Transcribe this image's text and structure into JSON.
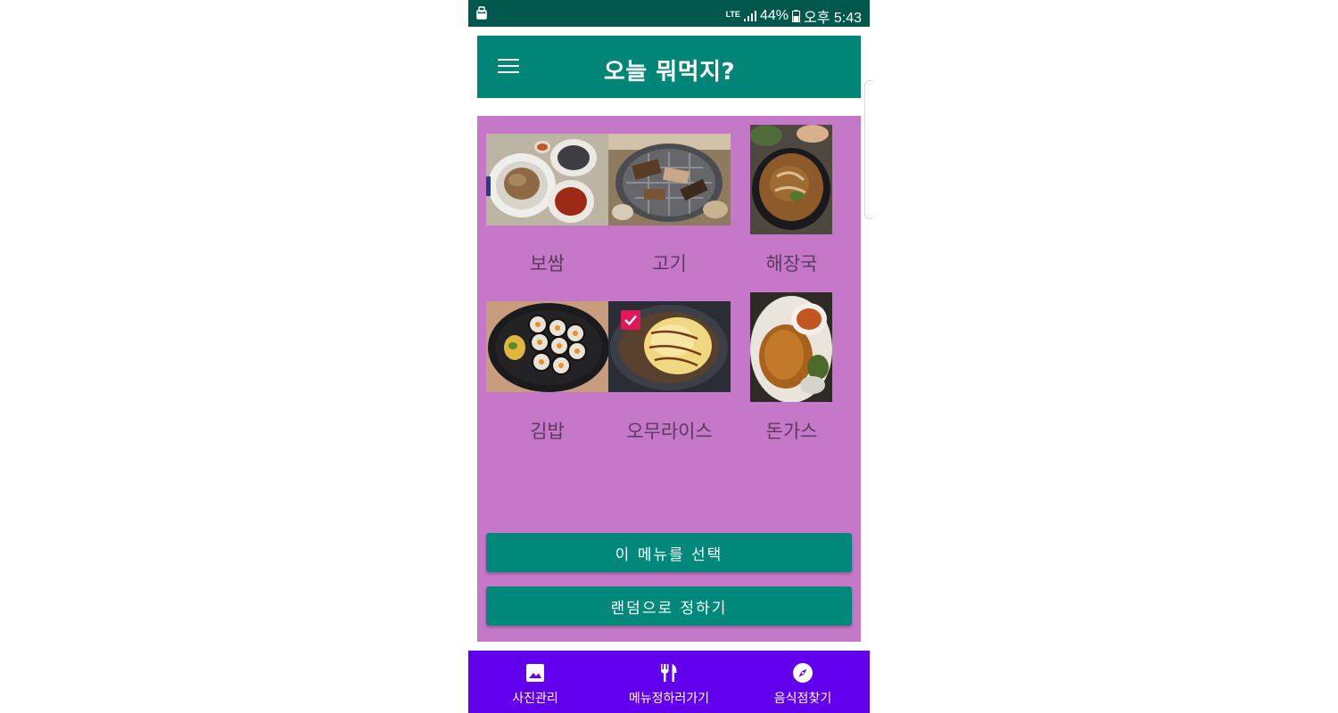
{
  "status_bar": {
    "network": "LTE",
    "battery": "44%",
    "time": "오후 5:43"
  },
  "app_bar": {
    "title": "오늘 뭐먹지?",
    "menu_icon": "hamburger-menu-icon"
  },
  "foods": [
    {
      "name": "보쌈",
      "selected": false
    },
    {
      "name": "고기",
      "selected": false
    },
    {
      "name": "해장국",
      "selected": false
    },
    {
      "name": "김밥",
      "selected": false
    },
    {
      "name": "오무라이스",
      "selected": true
    },
    {
      "name": "돈가스",
      "selected": false
    }
  ],
  "buttons": {
    "select": "이 메뉴를 선택",
    "random": "랜덤으로 정하기"
  },
  "bottom_nav": [
    {
      "label": "사진관리",
      "icon": "image-icon"
    },
    {
      "label": "메뉴정하러가기",
      "icon": "fork-knife-icon"
    },
    {
      "label": "음식점찾기",
      "icon": "compass-icon"
    }
  ],
  "colors": {
    "status_bar": "#00574b",
    "app_bar": "#008577",
    "content_background": "#c678c8",
    "button": "#00897b",
    "bottom_nav": "#6200ee",
    "checkbox": "#e0185a"
  }
}
